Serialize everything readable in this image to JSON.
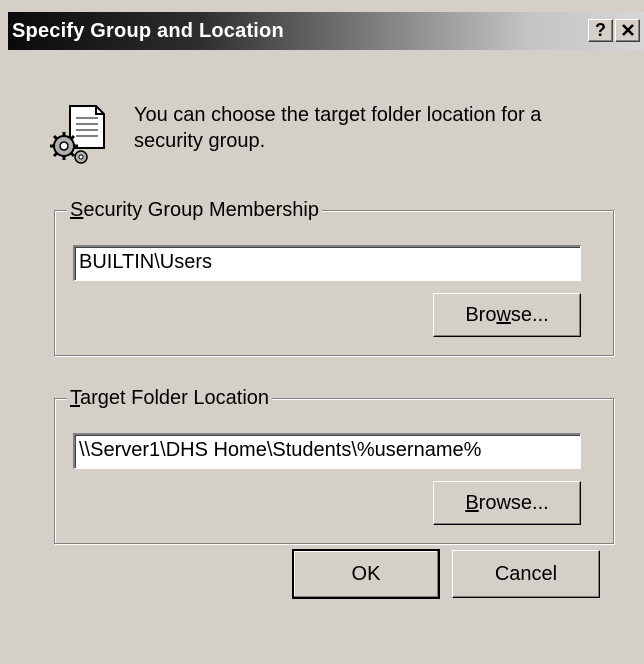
{
  "window": {
    "title": "Specify Group and Location",
    "help_button": "?",
    "close_button": "✕"
  },
  "intro": {
    "icon": "document-gear-icon",
    "text": "You can choose the target folder location for a security group."
  },
  "security_group": {
    "label_prefix": "",
    "label_underline": "S",
    "label_rest": "ecurity Group Membership",
    "value": "BUILTIN\\Users",
    "browse_prefix": "Bro",
    "browse_underline": "w",
    "browse_rest": "se..."
  },
  "target_folder": {
    "label_prefix": "",
    "label_underline": "T",
    "label_rest": "arget Folder Location",
    "value": "\\\\Server1\\DHS Home\\Students\\%username%",
    "browse_prefix": "",
    "browse_underline": "B",
    "browse_rest": "rowse..."
  },
  "buttons": {
    "ok": "OK",
    "cancel": "Cancel"
  }
}
